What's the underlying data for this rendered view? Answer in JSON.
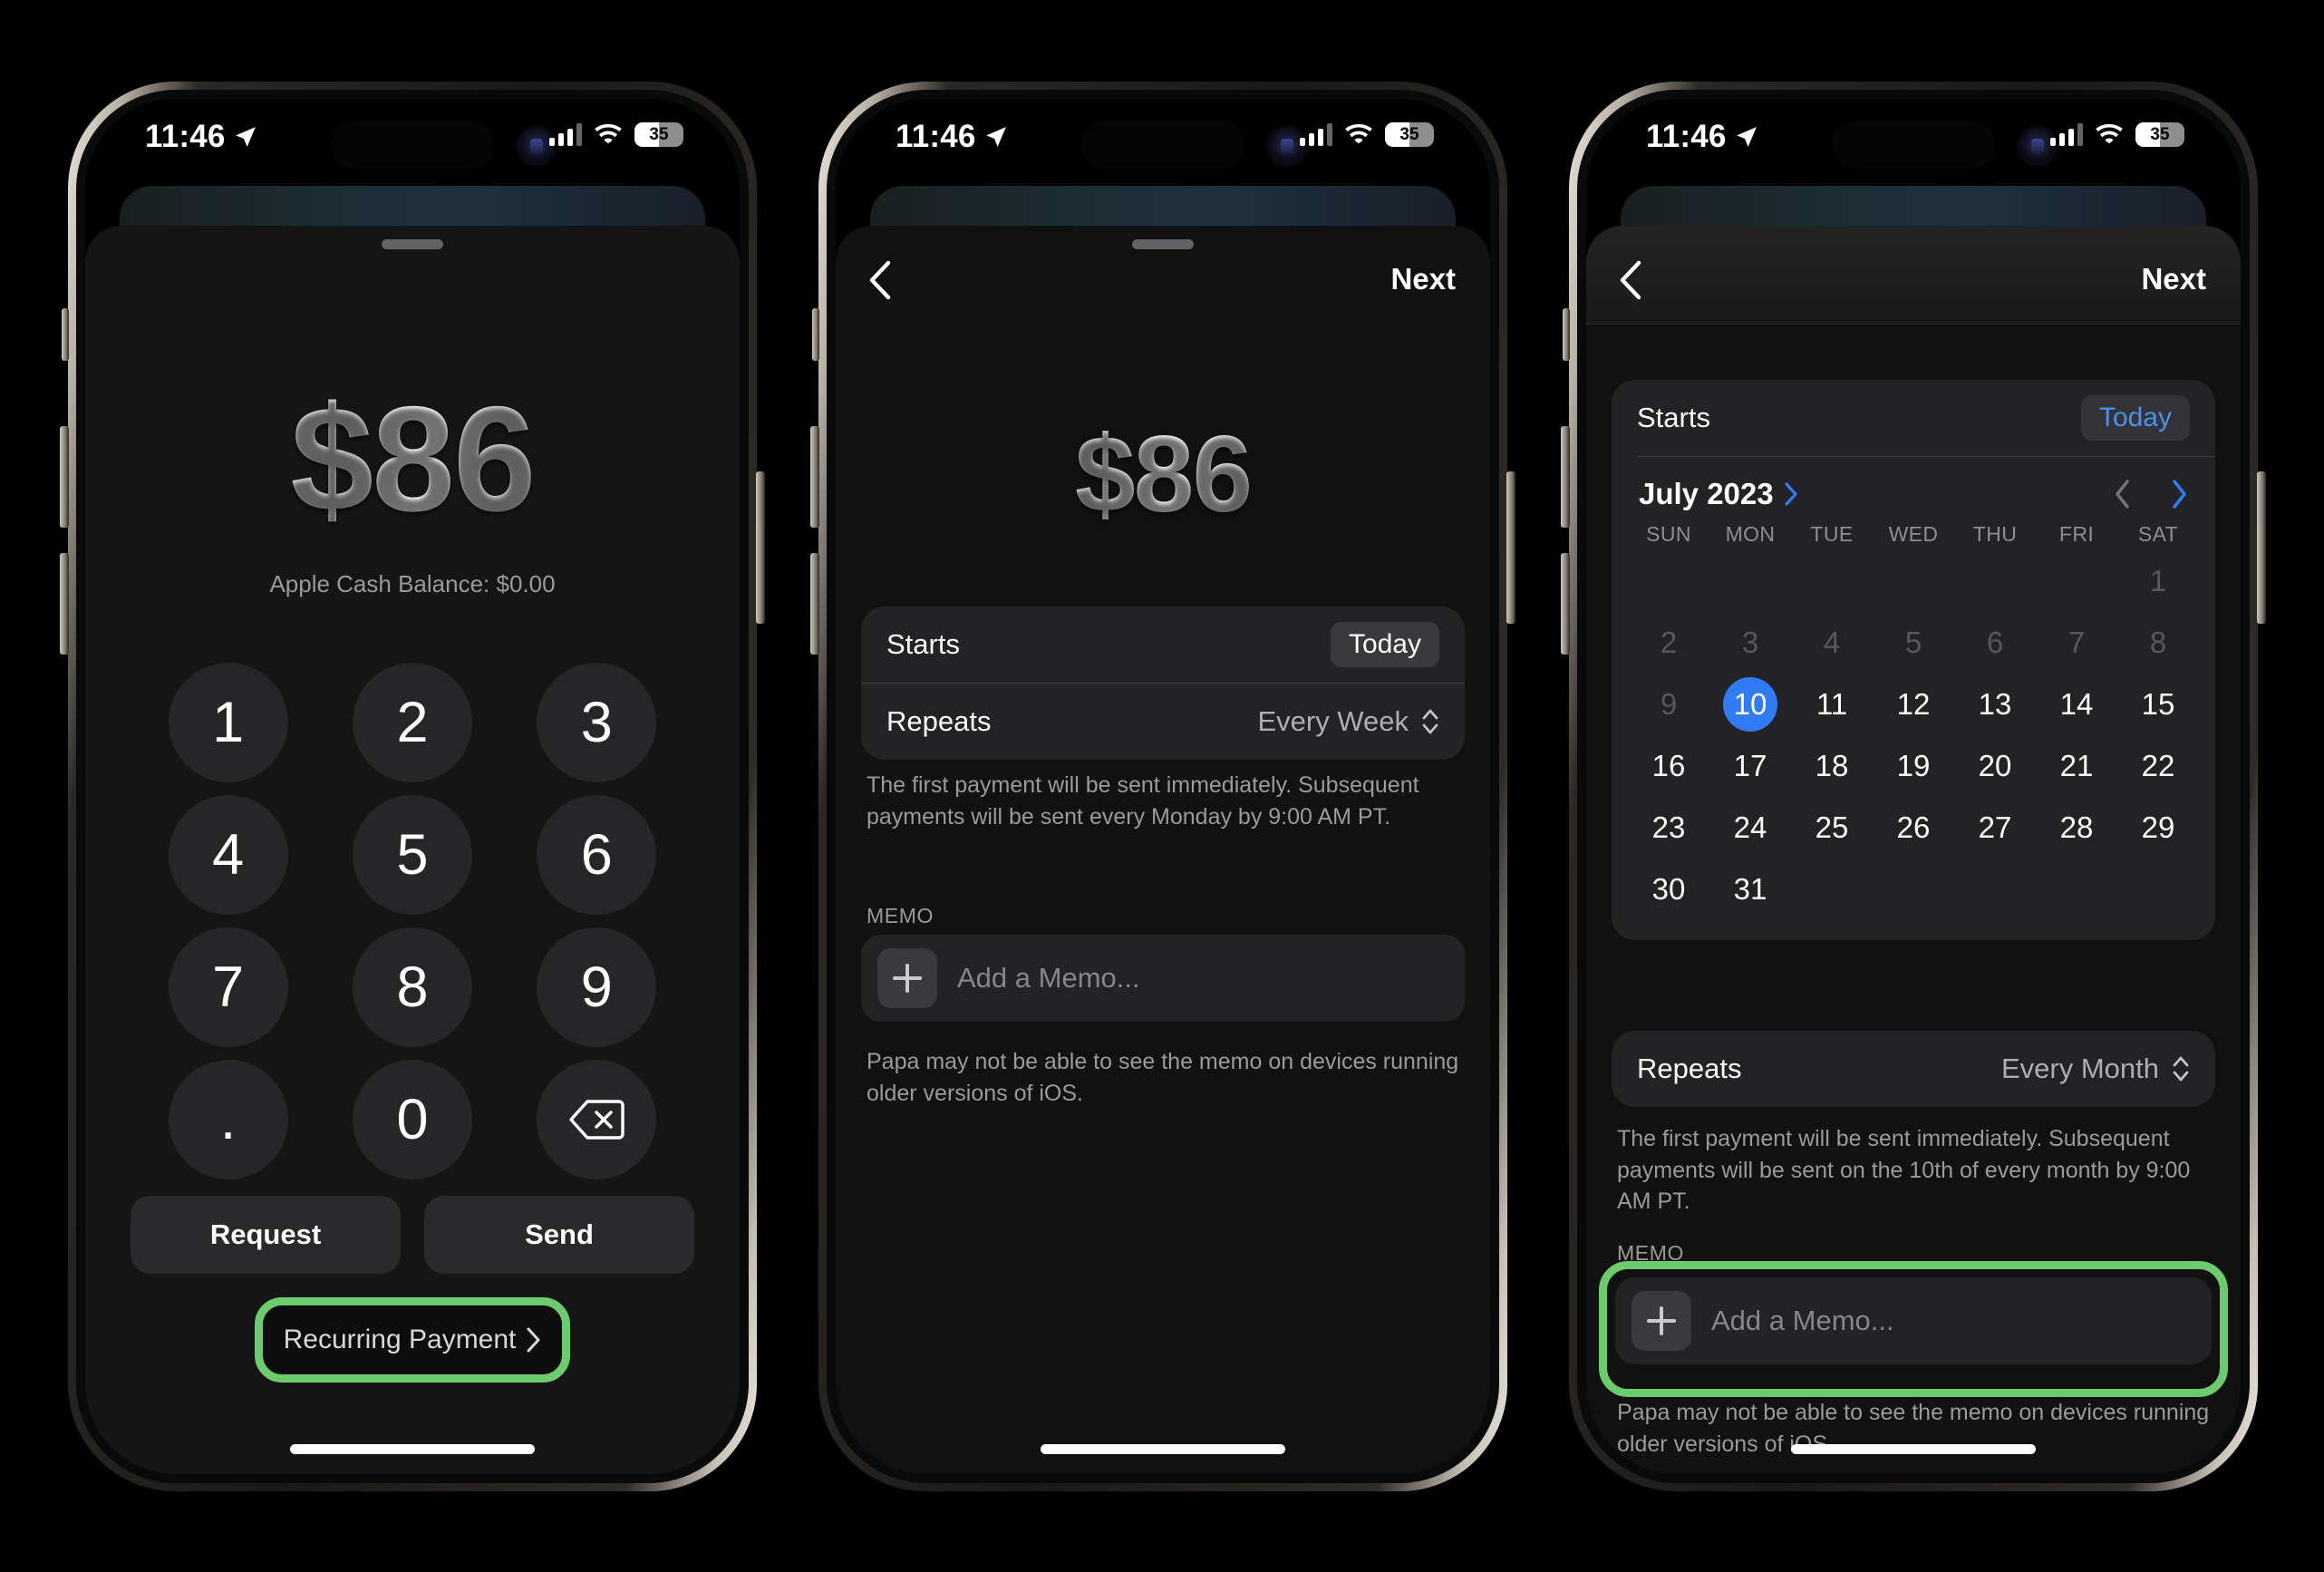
{
  "statusbar": {
    "time": "11:46",
    "battery_percent": "35",
    "location_icon": "location-arrow-icon",
    "cellular_icon": "cellular-bars-icon",
    "wifi_icon": "wifi-icon"
  },
  "screen1": {
    "amount": "$86",
    "balance": "Apple Cash Balance: $0.00",
    "keys": [
      "1",
      "2",
      "3",
      "4",
      "5",
      "6",
      "7",
      "8",
      "9",
      ".",
      "0",
      "delete-icon"
    ],
    "request_label": "Request",
    "send_label": "Send",
    "recurring_label": "Recurring Payment",
    "recurring_chevron": "chevron-right-icon",
    "highlight_color": "#6ccb6c"
  },
  "screen2": {
    "back_icon": "chevron-left-icon",
    "next_label": "Next",
    "amount": "$86",
    "starts_label": "Starts",
    "starts_value": "Today",
    "repeats_label": "Repeats",
    "repeats_value": "Every Week",
    "repeats_icon": "up-down-chevron-icon",
    "footnote": "The first payment will be sent immediately. Subsequent payments will be sent every Monday by 9:00 AM PT.",
    "memo_label": "MEMO",
    "memo_placeholder": "Add a Memo...",
    "memo_plus_icon": "plus-icon",
    "memo_footnote": "Papa may not be able to see the memo on devices running older versions of iOS."
  },
  "screen3": {
    "back_icon": "chevron-left-icon",
    "next_label": "Next",
    "starts_label": "Starts",
    "starts_value": "Today",
    "starts_value_color": "#4a90f0",
    "calendar": {
      "month_label": "July 2023",
      "month_chevron": "chevron-right-icon",
      "prev_icon": "chevron-left-icon",
      "next_icon": "chevron-right-icon",
      "weekdays": [
        "SUN",
        "MON",
        "TUE",
        "WED",
        "THU",
        "FRI",
        "SAT"
      ],
      "lead_blanks": 6,
      "days": [
        1,
        2,
        3,
        4,
        5,
        6,
        7,
        8,
        9,
        10,
        11,
        12,
        13,
        14,
        15,
        16,
        17,
        18,
        19,
        20,
        21,
        22,
        23,
        24,
        25,
        26,
        27,
        28,
        29,
        30,
        31
      ],
      "disabled_days": [
        1,
        2,
        3,
        4,
        5,
        6,
        7,
        8,
        9
      ],
      "selected_day": 10,
      "selected_color": "#2f7cf6"
    },
    "repeats_label": "Repeats",
    "repeats_value": "Every Month",
    "repeats_icon": "up-down-chevron-icon",
    "footnote": "The first payment will be sent immediately. Subsequent payments will be sent on the 10th of every month by 9:00 AM PT.",
    "memo_label": "MEMO",
    "memo_placeholder": "Add a Memo...",
    "memo_plus_icon": "plus-icon",
    "memo_footnote": "Papa may not be able to see the memo on devices running older versions of iOS.",
    "highlight_color": "#6ccb6c"
  }
}
